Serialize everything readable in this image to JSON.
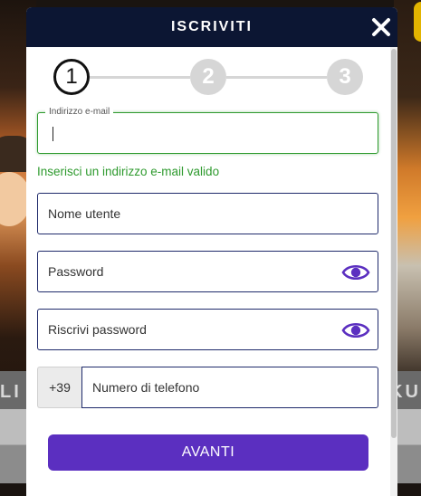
{
  "background": {
    "left_text": "LI",
    "right_text": "KU"
  },
  "modal": {
    "title": "ISCRIVITI",
    "close_icon": "close-icon"
  },
  "stepper": {
    "steps": [
      {
        "label": "1",
        "state": "active"
      },
      {
        "label": "2",
        "state": "inactive"
      },
      {
        "label": "3",
        "state": "inactive"
      }
    ]
  },
  "form": {
    "email": {
      "label": "Indirizzo e-mail",
      "value": "",
      "helper": "Inserisci un indirizzo e-mail valido"
    },
    "username": {
      "placeholder": "Nome utente"
    },
    "password": {
      "placeholder": "Password",
      "icon": "eye-icon"
    },
    "confirm_password": {
      "placeholder": "Riscrivi password",
      "icon": "eye-icon"
    },
    "phone": {
      "prefix": "+39",
      "placeholder": "Numero di telefono"
    },
    "submit_label": "AVANTI"
  },
  "colors": {
    "header_bg": "#0c1633",
    "accent_purple": "#5b2fc0",
    "valid_green": "#2e9a2e",
    "field_border": "#1f2a6b"
  }
}
